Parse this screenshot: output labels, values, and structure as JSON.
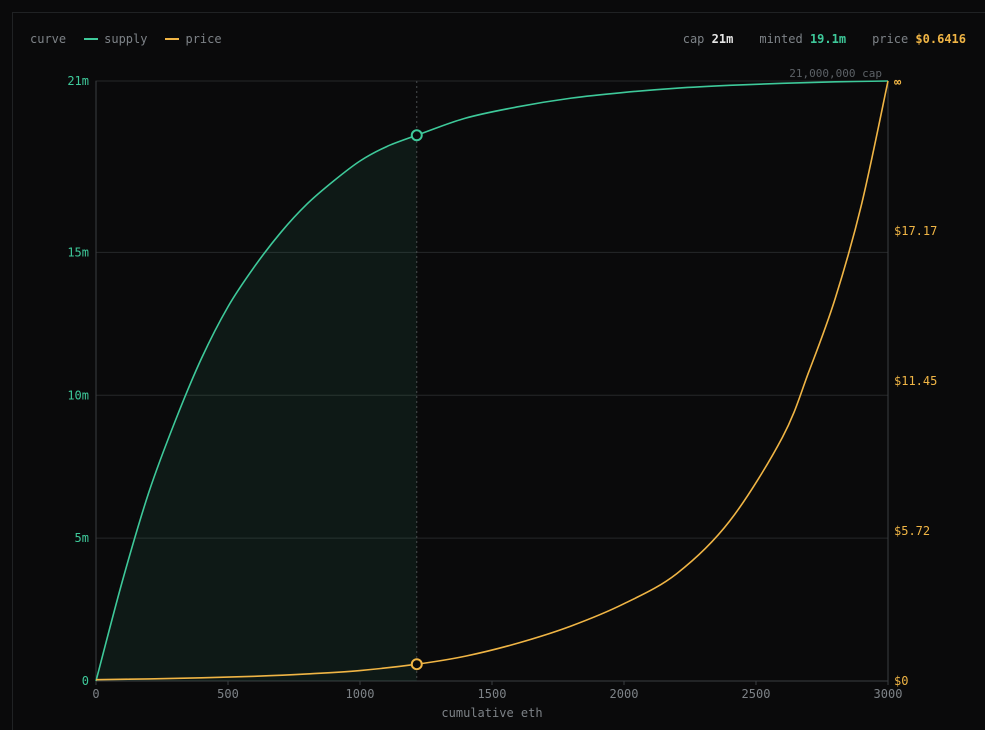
{
  "header": {
    "curve_label": "curve",
    "stats": [
      {
        "label": "cap",
        "value": "21m",
        "color": "#e6e6e6"
      },
      {
        "label": "minted",
        "value": "19.1m",
        "color": "#3ec99a"
      },
      {
        "label": "price",
        "value": "$0.6416",
        "color": "#f0b545"
      }
    ]
  },
  "colors": {
    "supply": "#3ec99a",
    "price": "#f0b545",
    "grid": "#26282a",
    "axis": "#3a3d40",
    "background": "#0a0a0b"
  },
  "chart_data": {
    "type": "line",
    "xlabel": "cumulative eth",
    "xlim": [
      0,
      3000
    ],
    "x_ticks": [
      0,
      500,
      1000,
      1500,
      2000,
      2500,
      3000
    ],
    "y_left": {
      "lim": [
        0,
        21000000
      ],
      "ticks": [
        {
          "value": 0,
          "label": "0"
        },
        {
          "value": 5000000,
          "label": "5m"
        },
        {
          "value": 10000000,
          "label": "10m"
        },
        {
          "value": 15000000,
          "label": "15m"
        },
        {
          "value": 21000000,
          "label": "21m"
        }
      ]
    },
    "y_right": {
      "lim": [
        0,
        22.9
      ],
      "ticks": [
        {
          "value": 0,
          "label": "$0"
        },
        {
          "value": 5.72,
          "label": "$5.72"
        },
        {
          "value": 11.45,
          "label": "$11.45"
        },
        {
          "value": 17.17,
          "label": "$17.17"
        },
        {
          "value": 22.9,
          "label": "∞"
        }
      ]
    },
    "cap_annotation": "21,000,000 cap",
    "series": [
      {
        "name": "supply",
        "axis": "left",
        "x": [
          0,
          100,
          200,
          300,
          400,
          500,
          600,
          700,
          800,
          900,
          1000,
          1100,
          1215,
          1400,
          1600,
          1800,
          2000,
          2200,
          2400,
          2600,
          2800,
          3000
        ],
        "y": [
          0,
          3500000,
          6600000,
          9100000,
          11300000,
          13100000,
          14500000,
          15700000,
          16700000,
          17500000,
          18200000,
          18700000,
          19100000,
          19700000,
          20100000,
          20400000,
          20600000,
          20750000,
          20850000,
          20920000,
          20970000,
          21000000
        ]
      },
      {
        "name": "price",
        "axis": "right",
        "x": [
          0,
          200,
          400,
          600,
          800,
          1000,
          1215,
          1400,
          1600,
          1800,
          2000,
          2200,
          2400,
          2600,
          2700,
          2800,
          2900,
          3000
        ],
        "y": [
          0.05,
          0.08,
          0.12,
          0.18,
          0.27,
          0.4,
          0.6416,
          0.95,
          1.45,
          2.1,
          2.95,
          4.1,
          6.1,
          9.3,
          11.8,
          14.6,
          18.2,
          22.9
        ]
      }
    ],
    "marker": {
      "x": 1215,
      "supply": 19100000,
      "price": 0.6416
    }
  }
}
